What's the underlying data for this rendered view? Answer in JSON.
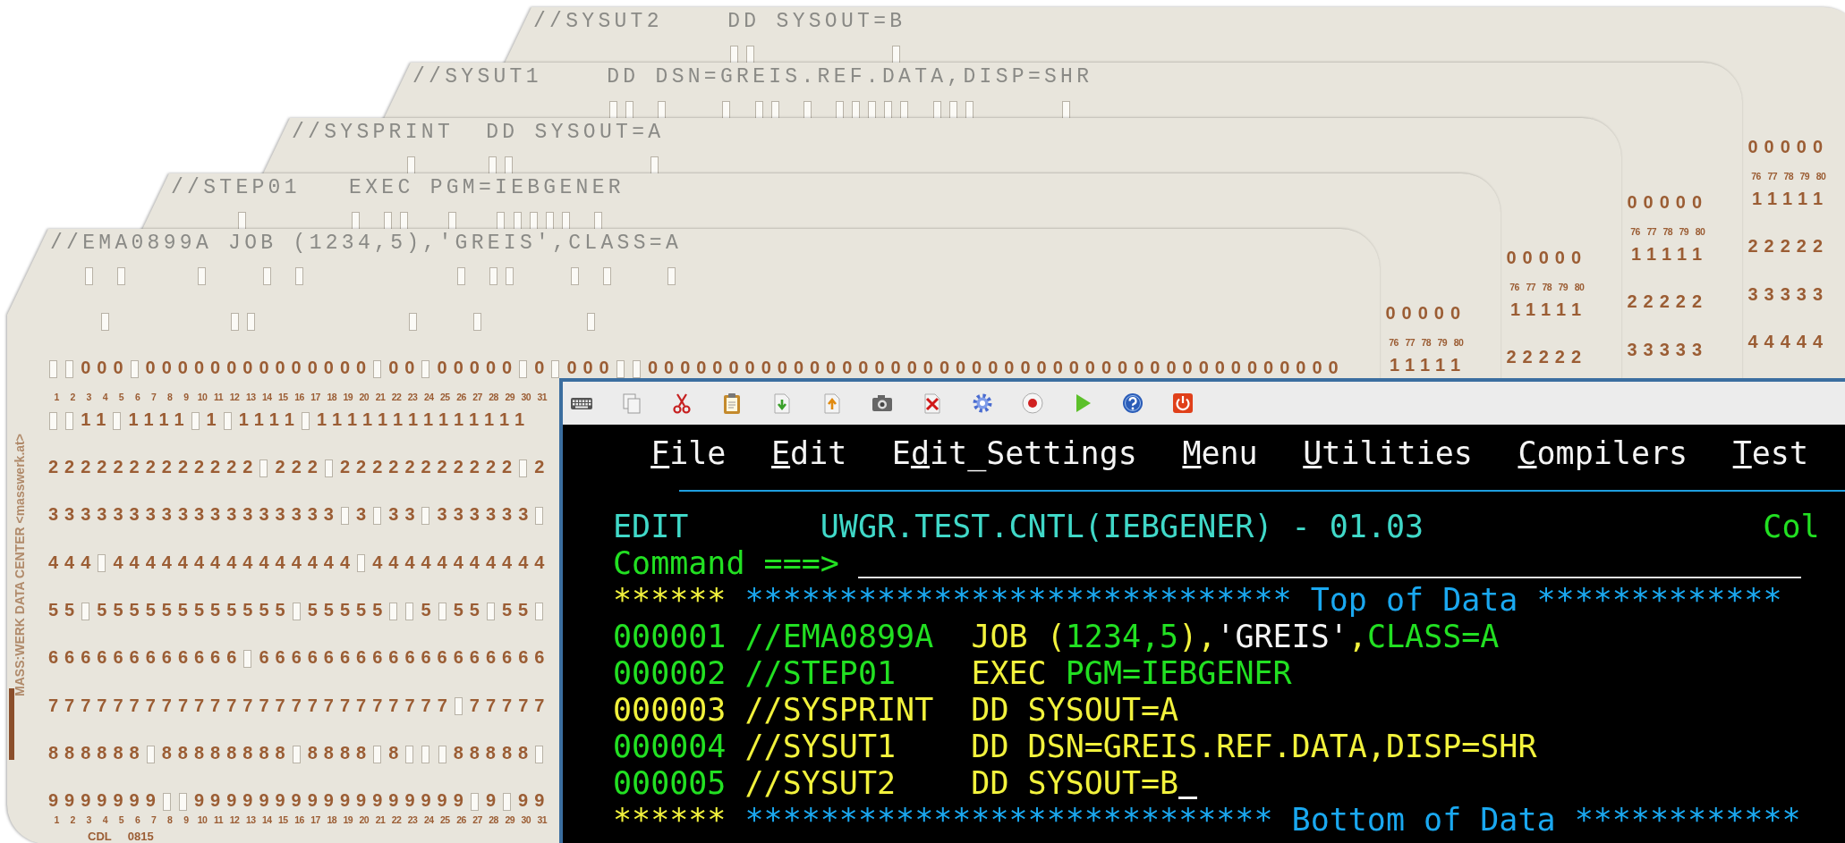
{
  "cards": [
    {
      "kind": "back",
      "header": "//SYSUT2    DD SYSOUT=B",
      "zones": [
        {
          "punched": [
            false,
            false,
            false,
            false,
            false,
            false,
            false,
            false,
            false,
            false,
            false,
            false,
            true,
            true,
            false,
            false,
            false,
            false,
            false,
            false,
            false,
            false,
            true
          ]
        }
      ],
      "rows": [
        {
          "kind": "digits",
          "cells": "00000"
        },
        {
          "kind": "numbers",
          "numbers": [
            "76",
            "77",
            "78",
            "79",
            "80"
          ]
        },
        {
          "kind": "digits",
          "cells": "11111"
        },
        {
          "kind": "digits",
          "cells": "22222"
        },
        {
          "kind": "digits",
          "cells": "33333"
        },
        {
          "kind": "digits",
          "cells": "44444"
        }
      ]
    },
    {
      "kind": "back",
      "header": "//SYSUT1    DD DSN=GREIS.REF.DATA,DISP=SHR",
      "zones": [
        {
          "punched": [
            false,
            false,
            false,
            false,
            false,
            false,
            false,
            false,
            false,
            false,
            false,
            false,
            true,
            true,
            false,
            true,
            false,
            false,
            false,
            true,
            false,
            true,
            true,
            false,
            true,
            false,
            true,
            true,
            true,
            true,
            true,
            false,
            true,
            true,
            true,
            false,
            false,
            false,
            false,
            false,
            true
          ]
        }
      ],
      "rows": [
        {
          "kind": "digits",
          "cells": "00000"
        },
        {
          "kind": "numbers",
          "numbers": [
            "76",
            "77",
            "78",
            "79",
            "80"
          ]
        },
        {
          "kind": "digits",
          "cells": "11111"
        },
        {
          "kind": "digits",
          "cells": "22222"
        },
        {
          "kind": "digits",
          "cells": "33333"
        }
      ]
    },
    {
      "kind": "back",
      "header": "//SYSPRINT  DD SYSOUT=A",
      "zones": [
        {
          "punched": [
            false,
            false,
            false,
            false,
            false,
            false,
            false,
            true,
            false,
            false,
            false,
            false,
            true,
            true,
            false,
            false,
            false,
            false,
            false,
            false,
            false,
            false,
            true
          ]
        }
      ],
      "rows": [
        {
          "kind": "digits",
          "cells": "00000"
        },
        {
          "kind": "numbers",
          "numbers": [
            "76",
            "77",
            "78",
            "79",
            "80"
          ]
        },
        {
          "kind": "digits",
          "cells": "11111"
        },
        {
          "kind": "digits",
          "cells": "22222"
        }
      ]
    },
    {
      "kind": "back",
      "header": "//STEP01   EXEC PGM=IEBGENER",
      "zones": [
        {
          "punched": [
            false,
            false,
            false,
            false,
            true,
            false,
            false,
            false,
            false,
            false,
            false,
            true,
            false,
            true,
            true,
            false,
            false,
            true,
            false,
            false,
            true,
            true,
            true,
            true,
            true,
            false,
            true
          ]
        }
      ],
      "rows": [
        {
          "kind": "digits",
          "cells": "00000"
        },
        {
          "kind": "numbers",
          "numbers": [
            "76",
            "77",
            "78",
            "79",
            "80"
          ]
        },
        {
          "kind": "digits",
          "cells": "11111"
        }
      ]
    },
    {
      "kind": "front",
      "header": "//EMA0899A JOB (1234,5),'GREIS',CLASS=A",
      "side_text": "MASS:WERK DATA CENTER <masswerk.at>",
      "footer": [
        "CDL",
        "0815"
      ],
      "zones": [
        {
          "punched": [
            false,
            false,
            true,
            false,
            true,
            false,
            false,
            false,
            false,
            true,
            false,
            false,
            false,
            true,
            false,
            true,
            false,
            false,
            false,
            false,
            false,
            false,
            false,
            false,
            false,
            true,
            false,
            true,
            true,
            false,
            false,
            false,
            true,
            false,
            true,
            false,
            false,
            false,
            true
          ]
        },
        {
          "punched": [
            false,
            false,
            false,
            true,
            false,
            false,
            false,
            false,
            false,
            false,
            false,
            true,
            true,
            false,
            false,
            false,
            false,
            false,
            false,
            false,
            false,
            false,
            true,
            false,
            false,
            false,
            true,
            false,
            false,
            false,
            false,
            false,
            false,
            true
          ]
        }
      ],
      "rows": [
        {
          "kind": "digits",
          "cells": "  000 00000000000000 00 00000 0 000  0000000000000000000000000000000000000000000"
        },
        {
          "kind": "numbers",
          "numbers": [
            "1",
            "2",
            "3",
            "4",
            "5",
            "6",
            "7",
            "8",
            "9",
            "10",
            "11",
            "12",
            "13",
            "14",
            "15",
            "16",
            "17",
            "18",
            "19",
            "20",
            "21",
            "22",
            "23",
            "24",
            "25",
            "26",
            "27",
            "28",
            "29",
            "30",
            "31"
          ]
        },
        {
          "kind": "digits",
          "cells": "  11 1111 1 1111 11111111111111"
        },
        {
          "kind": "digits",
          "cells": "2222222222222 222 22222222222 2"
        },
        {
          "kind": "digits",
          "cells": "333333333333333333 3 33 333333 "
        },
        {
          "kind": "digits",
          "cells": "444 444444444444444 44444444444"
        },
        {
          "kind": "digits",
          "cells": "55 555555555555 55555  5 55 55 "
        },
        {
          "kind": "digits",
          "cells": "666666666666 666666666666666666"
        },
        {
          "kind": "digits",
          "cells": "7777777777777777777777777 77777"
        },
        {
          "kind": "digits",
          "cells": "888888 88888888 8888 8   88888 "
        },
        {
          "kind": "digits",
          "cells": "9999999  99999999999999999 9 99"
        },
        {
          "kind": "numbers",
          "numbers": [
            "1",
            "2",
            "3",
            "4",
            "5",
            "6",
            "7",
            "8",
            "9",
            "10",
            "11",
            "12",
            "13",
            "14",
            "15",
            "16",
            "17",
            "18",
            "19",
            "20",
            "21",
            "22",
            "23",
            "24",
            "25",
            "26",
            "27",
            "28",
            "29",
            "30",
            "31"
          ]
        }
      ]
    }
  ],
  "terminal": {
    "toolbar": [
      {
        "kind": "keyboard"
      },
      {
        "kind": "copy"
      },
      {
        "kind": "cut"
      },
      {
        "kind": "paste"
      },
      {
        "kind": "download"
      },
      {
        "kind": "upload"
      },
      {
        "kind": "camera"
      },
      {
        "kind": "delete"
      },
      {
        "kind": "settings"
      },
      {
        "kind": "record"
      },
      {
        "kind": "play"
      },
      {
        "kind": "help"
      },
      {
        "kind": "power"
      }
    ],
    "menu": [
      {
        "key": "F",
        "after": "ile"
      },
      {
        "key": "E",
        "after": "dit"
      },
      {
        "before": "E",
        "key": "d",
        "after": "it_Settings"
      },
      {
        "key": "M",
        "after": "enu"
      },
      {
        "key": "U",
        "after": "tilities"
      },
      {
        "key": "C",
        "after": "ompilers"
      },
      {
        "key": "T",
        "after": "est"
      }
    ],
    "title_row": {
      "mode": "EDIT",
      "dataset": "UWGR.TEST.CNTL(IEBGENER) - 01.03",
      "column_label": "Col"
    },
    "command": {
      "label": "Command ===>"
    },
    "top_marker": {
      "prefix": "******",
      "text": "***************************** Top of Data *************"
    },
    "lines": [
      {
        "number": "000001",
        "highlighted": false,
        "cursor": false,
        "segments": [
          {
            "text": "//EMA0899A  ",
            "kind": "label"
          },
          {
            "text": "JOB (",
            "kind": "operator"
          },
          {
            "text": "1234,5",
            "kind": "operand"
          },
          {
            "text": "),",
            "kind": "operator"
          },
          {
            "text": "'GREIS'",
            "kind": "literal"
          },
          {
            "text": ",",
            "kind": "operator"
          },
          {
            "text": "CLASS=A",
            "kind": "operand"
          }
        ]
      },
      {
        "number": "000002",
        "highlighted": false,
        "cursor": false,
        "segments": [
          {
            "text": "//STEP01    ",
            "kind": "label"
          },
          {
            "text": "EXEC ",
            "kind": "operator"
          },
          {
            "text": "PGM=IEBGENER",
            "kind": "operand"
          }
        ]
      },
      {
        "number": "000003",
        "highlighted": true,
        "cursor": false,
        "segments": [
          {
            "text": "//SYSPRINT  DD SYSOUT=A",
            "kind": "operator"
          }
        ]
      },
      {
        "number": "000004",
        "highlighted": false,
        "cursor": false,
        "segments": [
          {
            "text": "//SYSUT1    DD DSN=GREIS.REF.DATA,DISP=SHR",
            "kind": "operator"
          }
        ]
      },
      {
        "number": "000005",
        "highlighted": false,
        "cursor": true,
        "segments": [
          {
            "text": "//SYSUT2    DD SYSOUT=B",
            "kind": "operator"
          }
        ]
      }
    ],
    "bottom_marker": {
      "prefix": "******",
      "text": "**************************** Bottom of Data ************"
    }
  }
}
